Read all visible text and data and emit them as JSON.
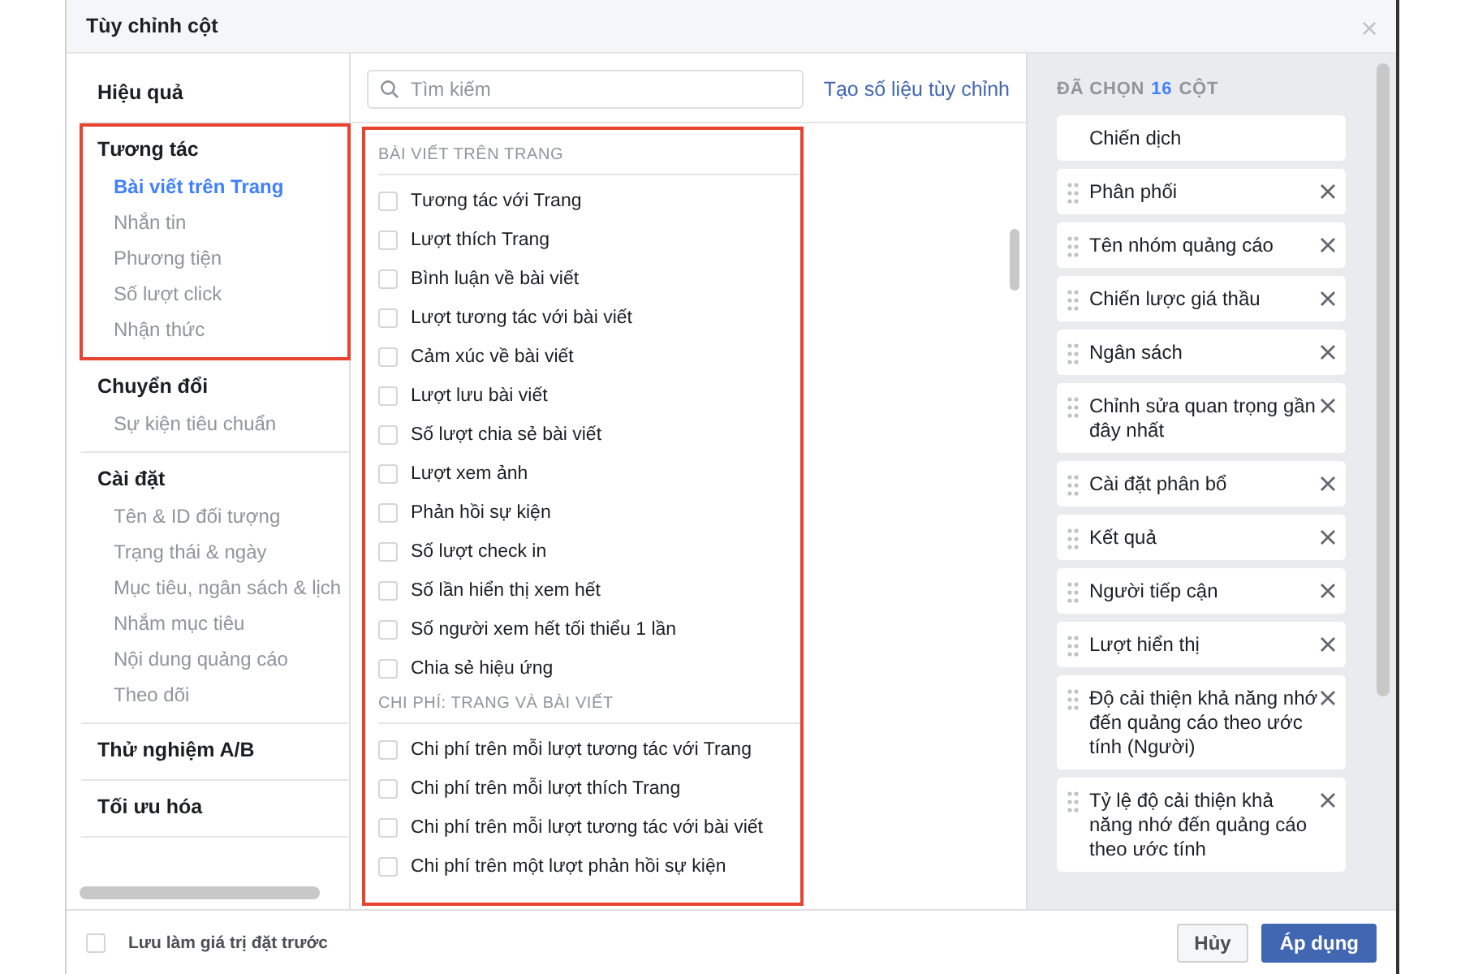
{
  "window": {
    "title": "Tùy chỉnh cột"
  },
  "sidebar": {
    "groups": [
      {
        "title": "Hiệu quả",
        "highlighted": false
      },
      {
        "title": "Tương tác",
        "highlighted": true,
        "items": [
          {
            "label": "Bài viết trên Trang",
            "selected": true
          },
          {
            "label": "Nhắn tin",
            "selected": false
          },
          {
            "label": "Phương tiện",
            "selected": false
          },
          {
            "label": "Số lượt click",
            "selected": false
          },
          {
            "label": "Nhận thức",
            "selected": false
          }
        ]
      },
      {
        "title": "Chuyển đổi",
        "highlighted": false,
        "items": [
          {
            "label": "Sự kiện tiêu chuẩn",
            "selected": false
          }
        ]
      },
      {
        "title": "Cài đặt",
        "highlighted": false,
        "items": [
          {
            "label": "Tên & ID đối tượng",
            "selected": false
          },
          {
            "label": "Trạng thái & ngày",
            "selected": false
          },
          {
            "label": "Mục tiêu, ngân sách & lịch",
            "selected": false
          },
          {
            "label": "Nhắm mục tiêu",
            "selected": false
          },
          {
            "label": "Nội dung quảng cáo",
            "selected": false
          },
          {
            "label": "Theo dõi",
            "selected": false
          }
        ]
      },
      {
        "title": "Thử nghiệm A/B",
        "highlighted": false
      },
      {
        "title": "Tối ưu hóa",
        "highlighted": false
      }
    ]
  },
  "search": {
    "placeholder": "Tìm kiếm"
  },
  "custom_metric_link": "Tạo số liệu tùy chỉnh",
  "metrics": {
    "highlighted": true,
    "sections": [
      {
        "heading": "BÀI VIẾT TRÊN TRANG",
        "items": [
          {
            "label": "Tương tác với Trang",
            "checked": false
          },
          {
            "label": "Lượt thích Trang",
            "checked": false
          },
          {
            "label": "Bình luận về bài viết",
            "checked": false
          },
          {
            "label": "Lượt tương tác với bài viết",
            "checked": false
          },
          {
            "label": "Cảm xúc về bài viết",
            "checked": false
          },
          {
            "label": "Lượt lưu bài viết",
            "checked": false
          },
          {
            "label": "Số lượt chia sẻ bài viết",
            "checked": false
          },
          {
            "label": "Lượt xem ảnh",
            "checked": false
          },
          {
            "label": "Phản hồi sự kiện",
            "checked": false
          },
          {
            "label": "Số lượt check in",
            "checked": false
          },
          {
            "label": "Số lần hiển thị xem hết",
            "checked": false
          },
          {
            "label": "Số người xem hết tối thiểu 1 lần",
            "checked": false
          },
          {
            "label": "Chia sẻ hiệu ứng",
            "checked": false
          }
        ]
      },
      {
        "heading": "CHI PHÍ: TRANG VÀ BÀI VIẾT",
        "items": [
          {
            "label": "Chi phí trên mỗi lượt tương tác với Trang",
            "checked": false
          },
          {
            "label": "Chi phí trên mỗi lượt thích Trang",
            "checked": false
          },
          {
            "label": "Chi phí trên mỗi lượt tương tác với bài viết",
            "checked": false
          },
          {
            "label": "Chi phí trên một lượt phản hồi sự kiện",
            "checked": false
          }
        ]
      }
    ]
  },
  "selected_columns": {
    "header_prefix": "ĐÃ CHỌN",
    "count": "16",
    "header_suffix": "CỘT",
    "items": [
      {
        "label": "Chiến dịch",
        "removable": false
      },
      {
        "label": "Phân phối",
        "removable": true
      },
      {
        "label": "Tên nhóm quảng cáo",
        "removable": true
      },
      {
        "label": "Chiến lược giá thầu",
        "removable": true
      },
      {
        "label": "Ngân sách",
        "removable": true
      },
      {
        "label": "Chỉnh sửa quan trọng gần đây nhất",
        "removable": true
      },
      {
        "label": "Cài đặt phân bổ",
        "removable": true
      },
      {
        "label": "Kết quả",
        "removable": true
      },
      {
        "label": "Người tiếp cận",
        "removable": true
      },
      {
        "label": "Lượt hiển thị",
        "removable": true
      },
      {
        "label": "Độ cải thiện khả năng nhớ đến quảng cáo theo ước tính (Người)",
        "removable": true
      },
      {
        "label": "Tỷ lệ độ cải thiện khả năng nhớ đến quảng cáo theo ước tính",
        "removable": true
      }
    ]
  },
  "footer": {
    "preset": {
      "label": "Lưu làm giá trị đặt trước",
      "checked": false
    },
    "buttons": [
      {
        "label": "Hủy",
        "kind": "secondary"
      },
      {
        "label": "Áp dụng",
        "kind": "primary"
      }
    ]
  }
}
